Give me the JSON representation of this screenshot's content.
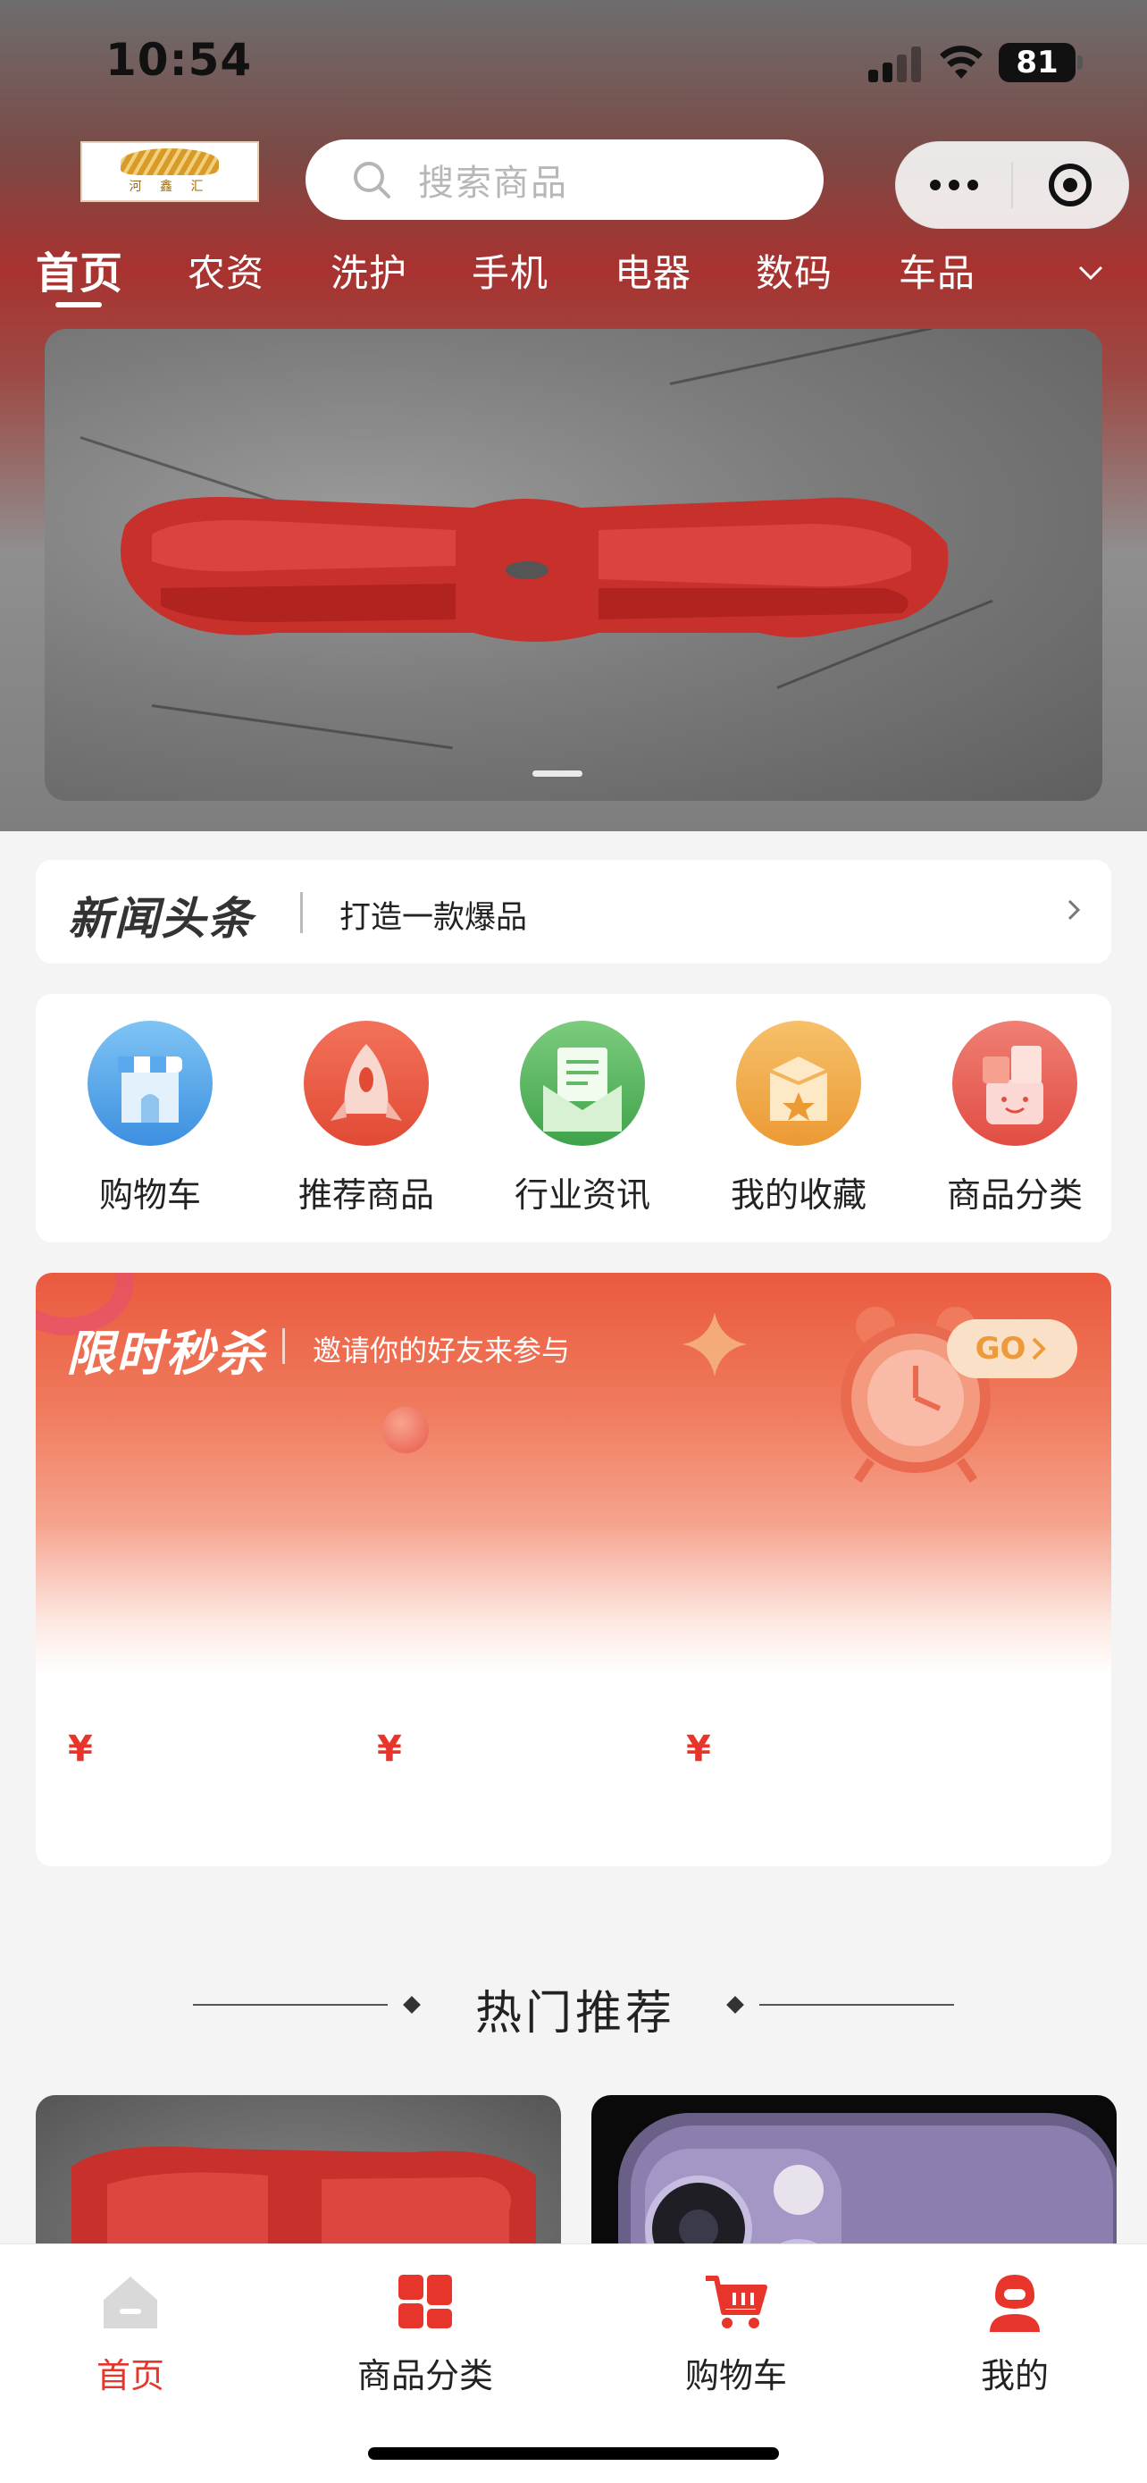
{
  "status_bar": {
    "time": "10:54",
    "battery": "81"
  },
  "header": {
    "logo_text": "河 鑫 汇",
    "search_placeholder": "搜索商品"
  },
  "category_tabs": [
    "首页",
    "农资",
    "洗护",
    "手机",
    "电器",
    "数码",
    "车品"
  ],
  "news": {
    "brand": "新闻头条",
    "headline": "打造一款爆品"
  },
  "quick_menu": [
    {
      "label": "购物车",
      "icon": "shop-icon"
    },
    {
      "label": "推荐商品",
      "icon": "rocket-icon"
    },
    {
      "label": "行业资讯",
      "icon": "envelope-icon"
    },
    {
      "label": "我的收藏",
      "icon": "favorites-box-icon"
    },
    {
      "label": "商品分类",
      "icon": "category-box-icon"
    }
  ],
  "flash_sale": {
    "title": "限时秒杀",
    "subtitle": "邀请你的好友来参与",
    "go_label": "GO",
    "prices": [
      "¥",
      "¥",
      "¥"
    ]
  },
  "hot": {
    "title": "热门推荐"
  },
  "tabbar": [
    {
      "label": "首页",
      "icon": "home-icon",
      "active": true
    },
    {
      "label": "商品分类",
      "icon": "category-grid-icon",
      "active": false
    },
    {
      "label": "购物车",
      "icon": "cart-icon",
      "active": false
    },
    {
      "label": "我的",
      "icon": "user-icon",
      "active": false
    }
  ],
  "colors": {
    "accent": "#e8352b",
    "header_red": "#a8322f",
    "go_text": "#ee9a3a"
  }
}
